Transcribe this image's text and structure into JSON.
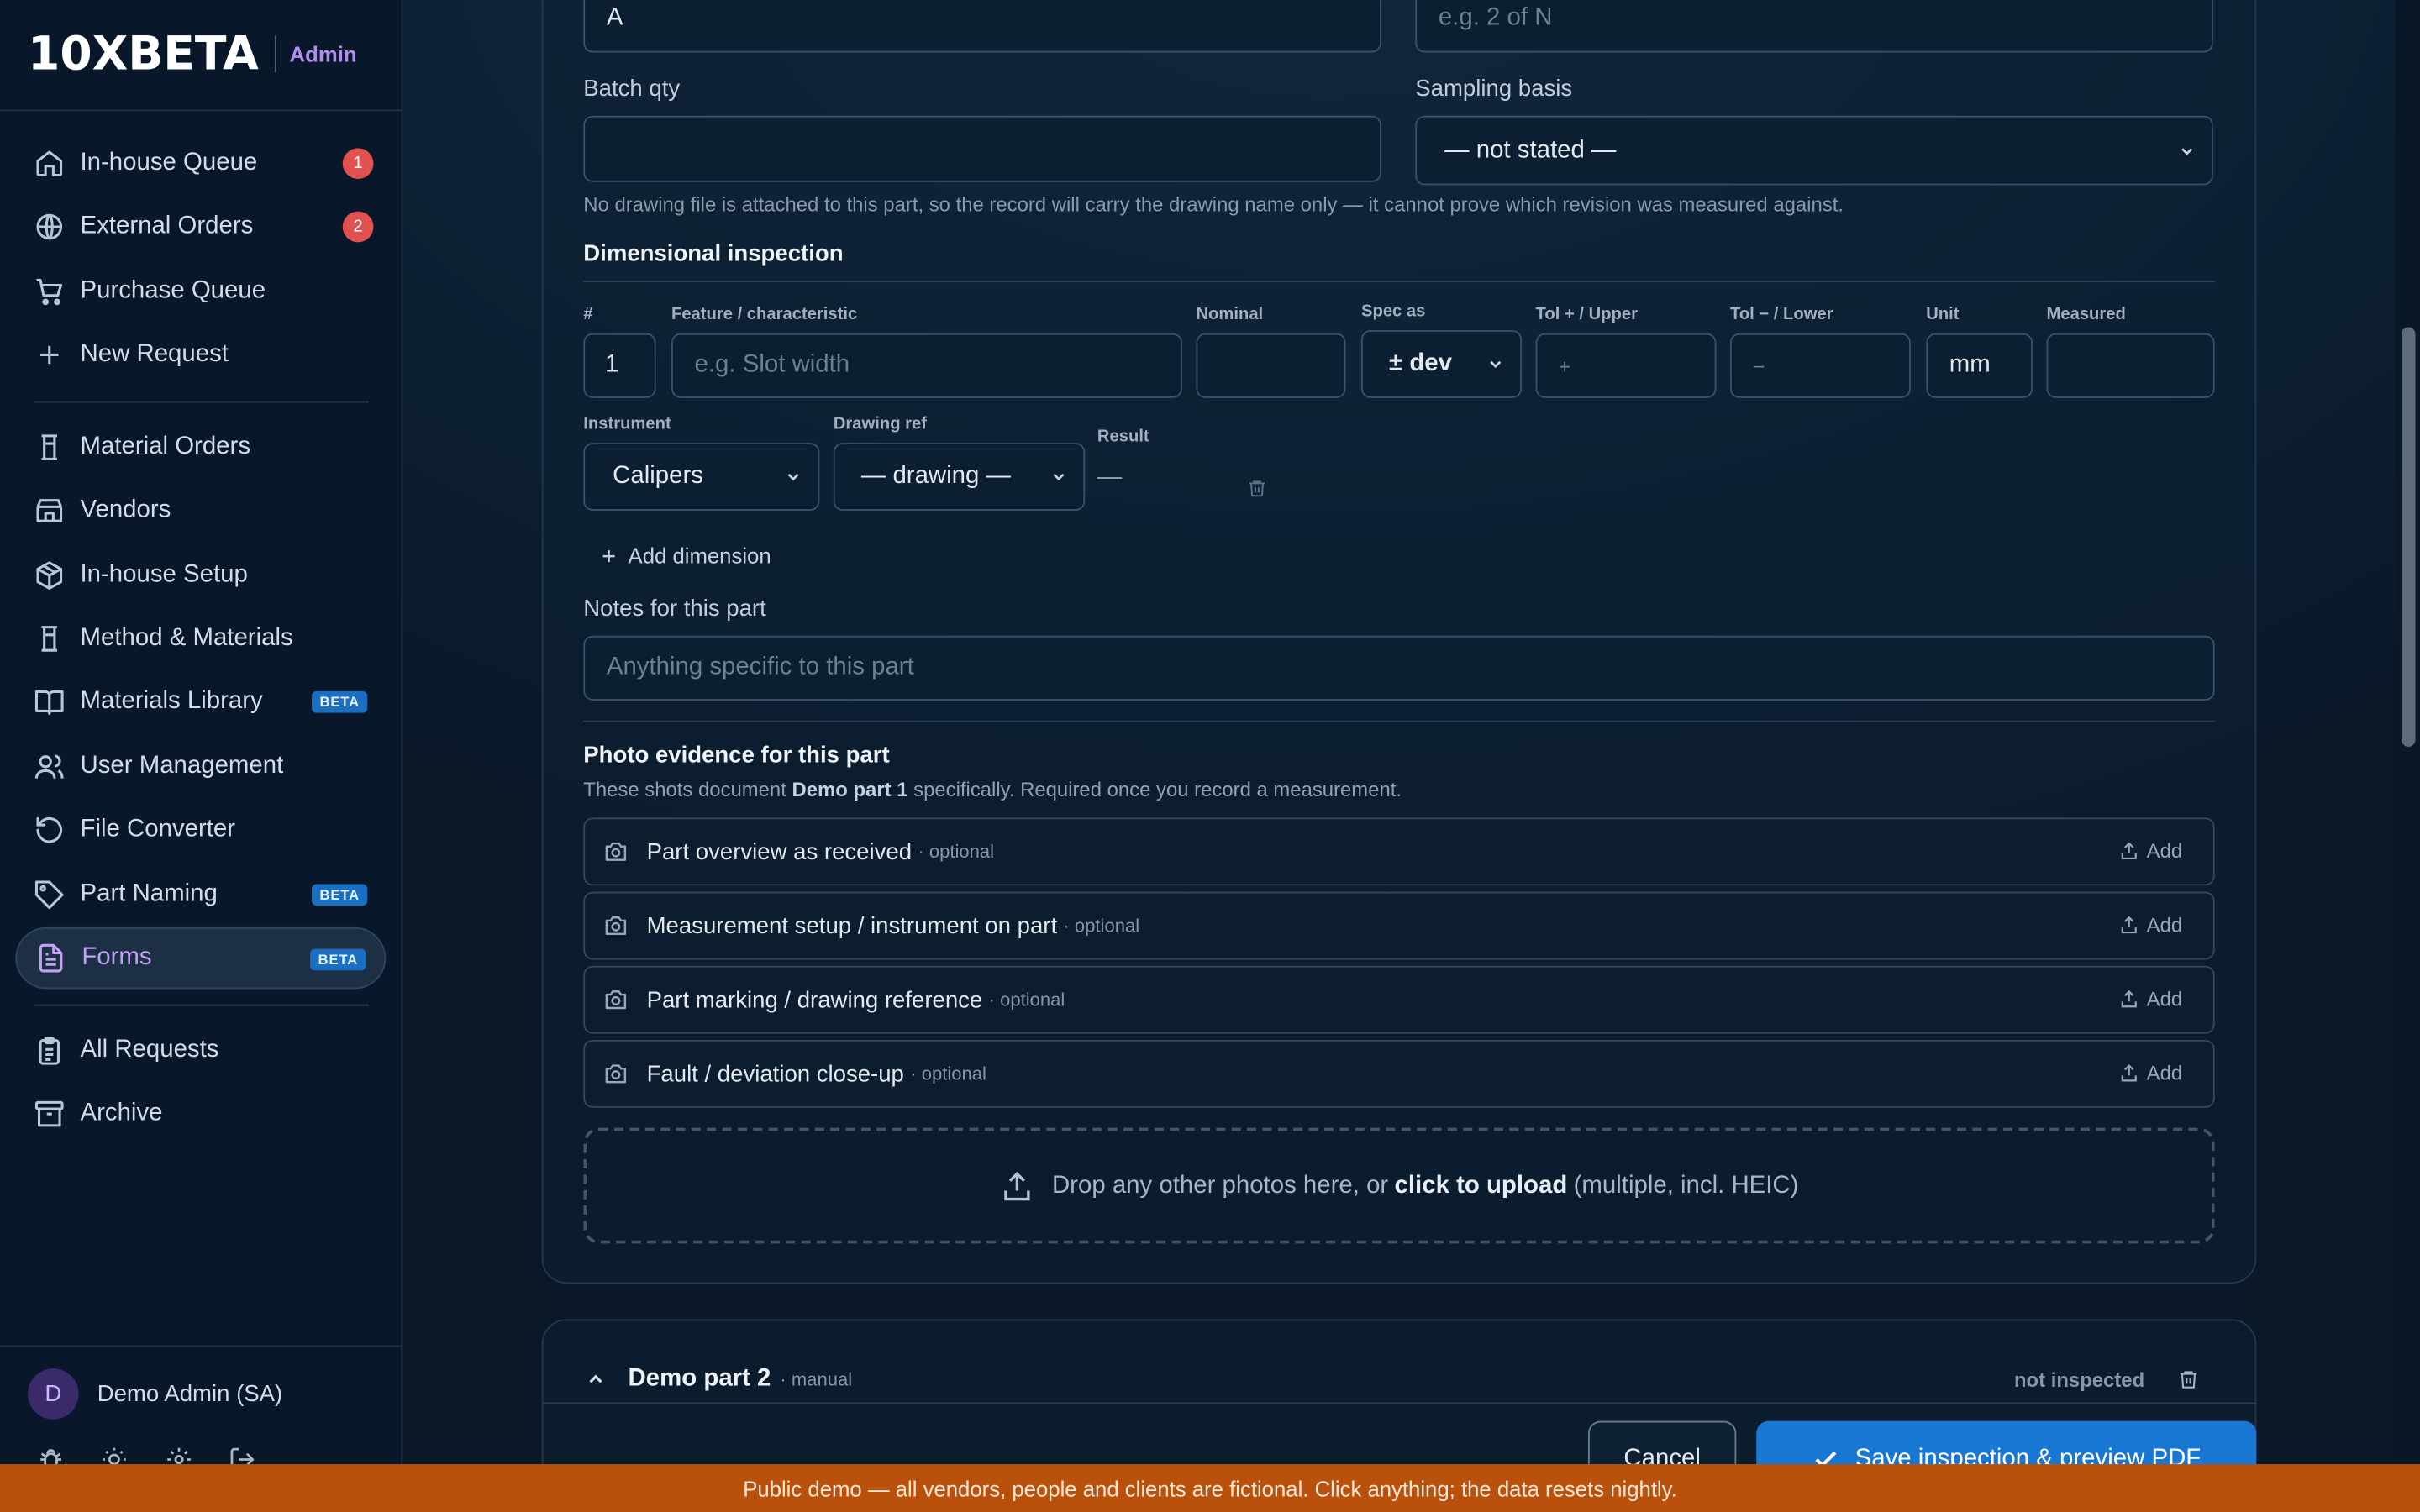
{
  "brand": {
    "logo": "10XBETA",
    "role": "Admin"
  },
  "sidebar": {
    "items": [
      {
        "label": "In-house Queue",
        "icon": "home-icon",
        "badge": "1"
      },
      {
        "label": "External Orders",
        "icon": "globe-icon",
        "badge": "2"
      },
      {
        "label": "Purchase Queue",
        "icon": "cart-icon"
      },
      {
        "label": "New Request",
        "icon": "plus-icon"
      },
      {
        "label": "Material Orders",
        "icon": "cylinder-icon"
      },
      {
        "label": "Vendors",
        "icon": "store-icon"
      },
      {
        "label": "In-house Setup",
        "icon": "box-icon"
      },
      {
        "label": "Method & Materials",
        "icon": "cylinder-icon"
      },
      {
        "label": "Materials Library",
        "icon": "book-icon",
        "badge": "BETA"
      },
      {
        "label": "User Management",
        "icon": "users-icon"
      },
      {
        "label": "File Converter",
        "icon": "refresh-icon"
      },
      {
        "label": "Part Naming",
        "icon": "tag-icon",
        "badge": "BETA"
      },
      {
        "label": "Forms",
        "icon": "form-icon",
        "badge": "BETA",
        "active": true
      },
      {
        "label": "All Requests",
        "icon": "clipboard-icon"
      },
      {
        "label": "Archive",
        "icon": "archive-icon"
      }
    ],
    "user": {
      "initial": "D",
      "name": "Demo Admin (SA)"
    },
    "footer_icons": [
      "bug-icon",
      "sun-icon",
      "settings-icon",
      "logout-icon"
    ]
  },
  "form": {
    "rev_value": "A",
    "part_of_placeholder": "e.g. 2 of N",
    "batch_qty_label": "Batch qty",
    "batch_qty_value": "",
    "sampling_label": "Sampling basis",
    "sampling_value": "— not stated —",
    "drawing_note": "No drawing file is attached to this part, so the record will carry the drawing name only — it cannot prove which revision was measured against."
  },
  "dimensional": {
    "title": "Dimensional inspection",
    "headers": {
      "num": "#",
      "feature": "Feature / characteristic",
      "nominal": "Nominal",
      "spec": "Spec as",
      "tol_upper": "Tol + / Upper",
      "tol_lower": "Tol − / Lower",
      "unit": "Unit",
      "measured": "Measured",
      "instrument": "Instrument",
      "drawing_ref": "Drawing ref",
      "result": "Result"
    },
    "row": {
      "num": "1",
      "feature_placeholder": "e.g. Slot width",
      "nominal": "",
      "spec": "± dev",
      "tol_upper_placeholder": "+",
      "tol_lower_placeholder": "−",
      "unit": "mm",
      "measured": "",
      "instrument": "Calipers",
      "drawing_ref": "— drawing —",
      "result": "—"
    },
    "add_label": "Add dimension"
  },
  "notes": {
    "label": "Notes for this part",
    "placeholder": "Anything specific to this part"
  },
  "photos": {
    "title": "Photo evidence for this part",
    "desc_pre": "These shots document ",
    "desc_part": "Demo part 1",
    "desc_post": " specifically. Required once you record a measurement.",
    "items": [
      {
        "label": "Part overview as received",
        "optional": "· optional",
        "add": "Add"
      },
      {
        "label": "Measurement setup / instrument on part",
        "optional": "· optional",
        "add": "Add"
      },
      {
        "label": "Part marking / drawing reference",
        "optional": "· optional",
        "add": "Add"
      },
      {
        "label": "Fault / deviation close-up",
        "optional": "· optional",
        "add": "Add"
      }
    ],
    "drop_pre": "Drop any other photos here, or ",
    "drop_link": "click to upload",
    "drop_post": " (multiple, incl. HEIC)"
  },
  "part2": {
    "name": "Demo part 2",
    "source": "· manual",
    "status": "not inspected"
  },
  "actions": {
    "cancel": "Cancel",
    "save": "Save inspection & preview PDF"
  },
  "banner": "Public demo — all vendors, people and clients are fictional. Click anything; the data resets nightly."
}
